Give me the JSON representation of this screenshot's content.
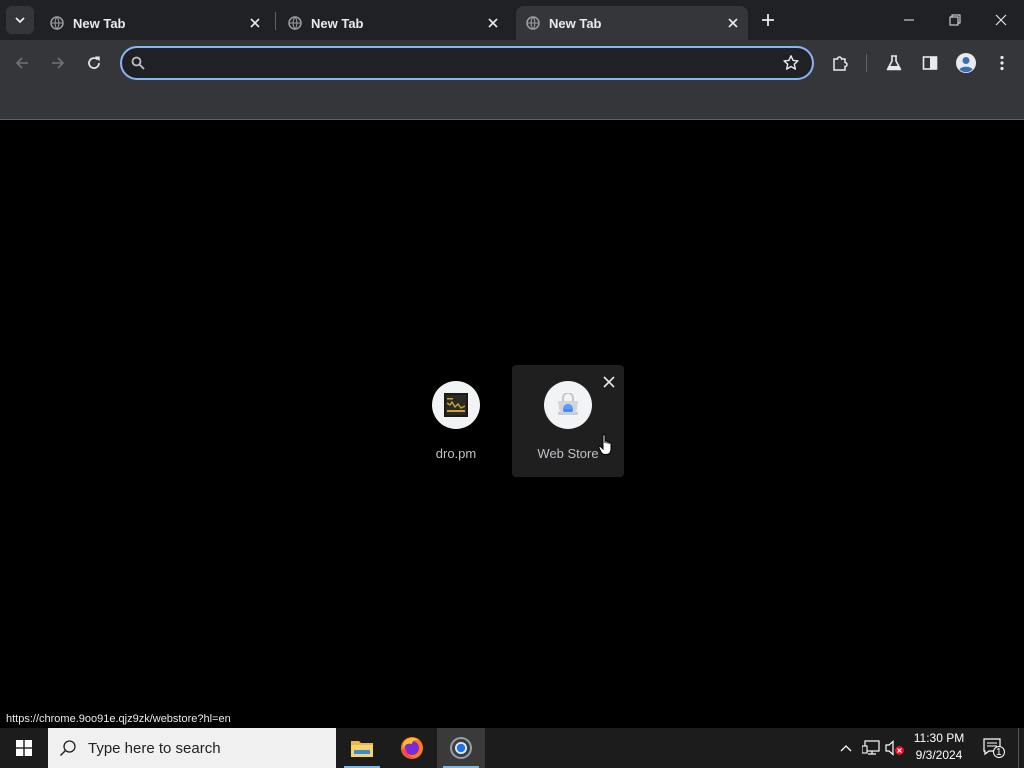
{
  "browser": {
    "tabs": [
      {
        "title": "New Tab",
        "active": false
      },
      {
        "title": "New Tab",
        "active": false
      },
      {
        "title": "New Tab",
        "active": true
      }
    ],
    "omnibox": {
      "value": "",
      "placeholder": ""
    },
    "accent_color": "#8ab4f8"
  },
  "shortcuts": [
    {
      "label": "dro.pm",
      "icon": "dro-pm-favicon"
    },
    {
      "label": "Web Store",
      "icon": "web-store-icon"
    }
  ],
  "status_bar": {
    "url": "https://chrome.9oo91e.qjz9zk/webstore?hl=en"
  },
  "taskbar": {
    "search_placeholder": "Type here to search",
    "apps": [
      "file-explorer-icon",
      "firefox-icon",
      "chrome-icon"
    ],
    "clock_time": "11:30 PM",
    "clock_date": "9/3/2024",
    "notification_count": "1"
  }
}
